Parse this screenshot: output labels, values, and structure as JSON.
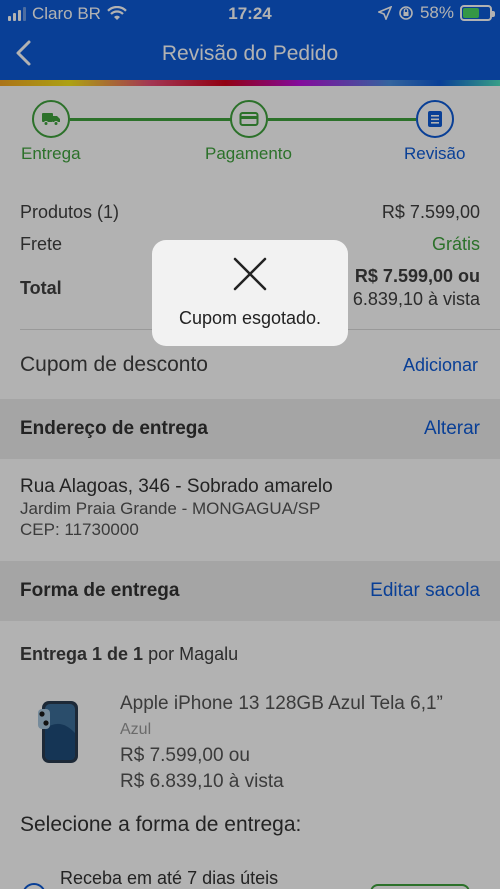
{
  "status_bar": {
    "carrier": "Claro BR",
    "time": "17:24",
    "battery": "58%",
    "battery_level": 0.58
  },
  "nav": {
    "back_icon": "chevron-left-icon",
    "title": "Revisão do Pedido"
  },
  "stepper": {
    "steps": [
      {
        "label": "Entrega",
        "icon": "truck-icon",
        "state": "done"
      },
      {
        "label": "Pagamento",
        "icon": "credit-card-icon",
        "state": "done"
      },
      {
        "label": "Revisão",
        "icon": "document-icon",
        "state": "current"
      }
    ]
  },
  "summary": {
    "products_label": "Produtos (1)",
    "products_value": "R$ 7.599,00",
    "shipping_label": "Frete",
    "shipping_value": "Grátis",
    "total_label": "Total",
    "total_value_line1": "R$ 7.599,00 ou",
    "total_value_line2": "R$ 6.839,10 à vista"
  },
  "coupon": {
    "label": "Cupom de desconto",
    "action": "Adicionar"
  },
  "address_section": {
    "title": "Endereço de entrega",
    "action": "Alterar",
    "line1": "Rua Alagoas, 346 - Sobrado amarelo",
    "line2": "Jardim Praia Grande - MONGAGUA/SP",
    "line3": "CEP: 11730000"
  },
  "delivery_section": {
    "title": "Forma de entrega",
    "action": "Editar sacola",
    "count_bold": "Entrega 1 de 1",
    "count_rest": "por Magalu",
    "product": {
      "name": "Apple iPhone 13 128GB Azul Tela 6,1”",
      "color": "Azul",
      "price_line1": "R$ 7.599,00 ou",
      "price_line2": "R$ 6.839,10 à vista"
    },
    "select_title": "Selecione a forma de entrega:",
    "option_text": "Receba em até 7 dias úteis"
  },
  "toast": {
    "icon": "close-icon",
    "message": "Cupom esgotado."
  },
  "colors": {
    "brand_blue": "#0e5bd7",
    "success_green": "#3fa33d",
    "section_gray": "#ededed"
  }
}
